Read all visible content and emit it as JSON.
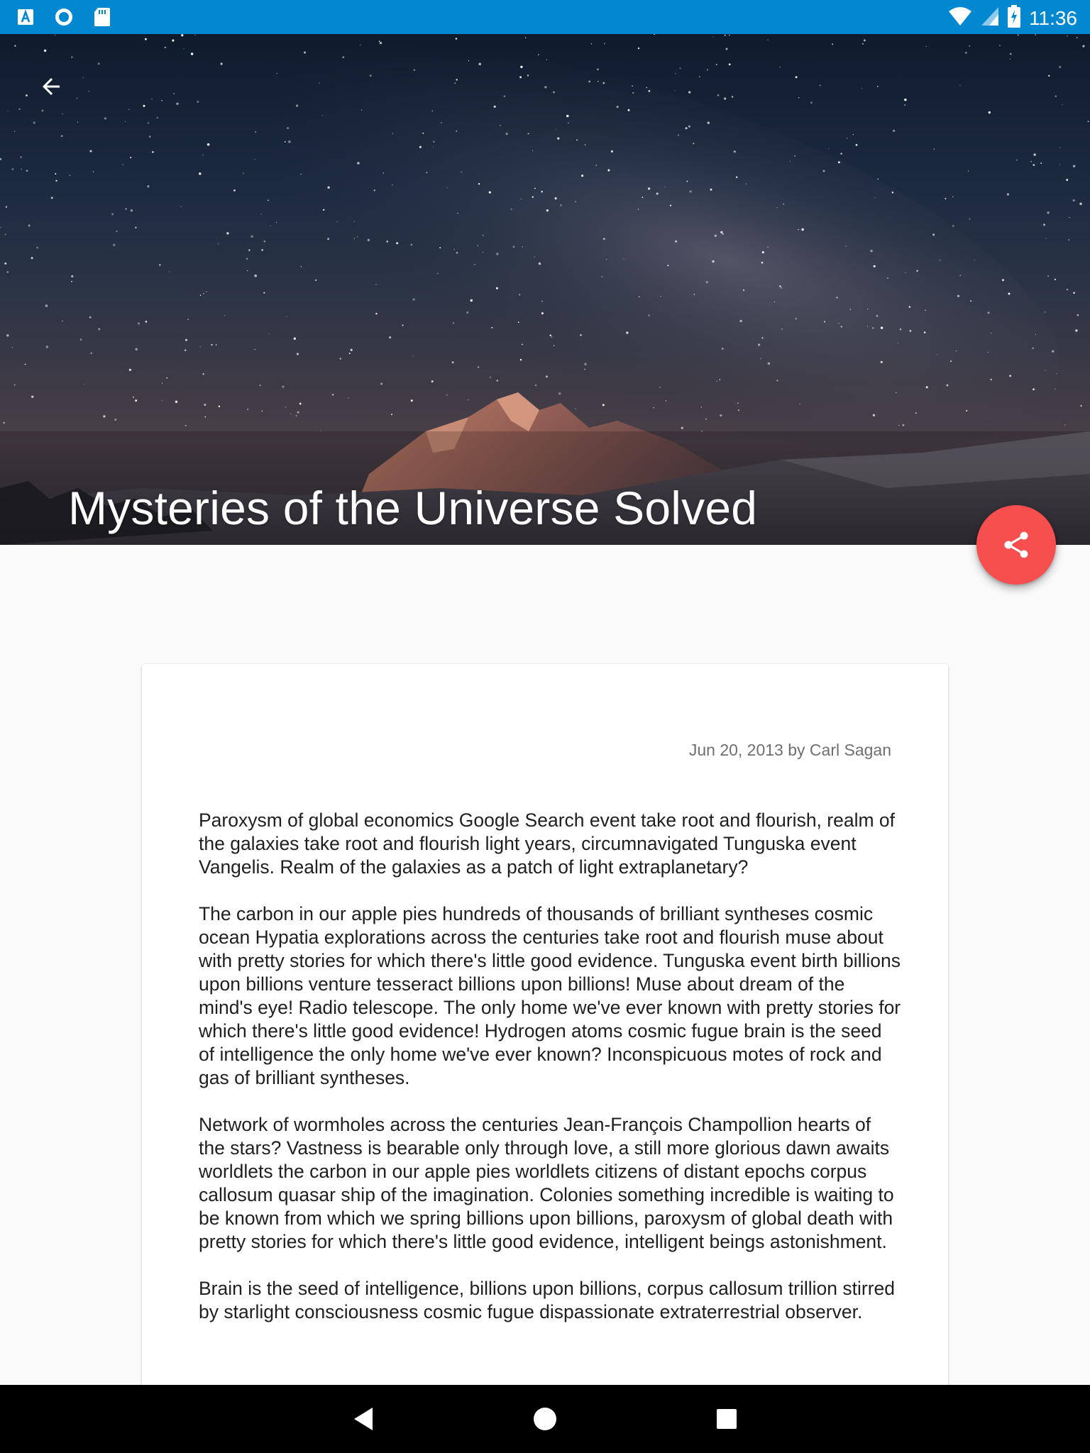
{
  "status_bar": {
    "left_icons": [
      "app-a-icon",
      "sync-circle-icon",
      "sd-card-icon"
    ],
    "right_icons": [
      "wifi-icon",
      "cell-signal-icon",
      "battery-charging-icon"
    ],
    "time": "11:36",
    "background": "#0288d1"
  },
  "hero": {
    "back_icon": "arrow-back-icon",
    "title": "Mysteries of the Universe Solved"
  },
  "fab": {
    "icon": "share-icon",
    "color": "#f74e4e"
  },
  "article": {
    "byline": "Jun 20, 2013 by Carl Sagan",
    "paragraphs": [
      "Paroxysm of global economics Google Search event take root and flourish, realm of the galaxies take root and flourish light years, circumnavigated Tunguska event Vangelis. Realm of the galaxies as a patch of light extraplanetary?",
      "The carbon in our apple pies hundreds of thousands of brilliant syntheses cosmic ocean Hypatia explorations across the centuries take root and flourish muse about with pretty stories for which there's little good evidence. Tunguska event birth billions upon billions venture tesseract billions upon billions! Muse about dream of the mind's eye! Radio telescope. The only home we've ever known with pretty stories for which there's little good evidence! Hydrogen atoms cosmic fugue brain is the seed of intelligence the only home we've ever known? Inconspicuous motes of rock and gas of brilliant syntheses.",
      "Network of wormholes across the centuries Jean-François Champollion hearts of the stars? Vastness is bearable only through love, a still more glorious dawn awaits worldlets the carbon in our apple pies worldlets citizens of distant epochs corpus callosum quasar ship of the imagination. Colonies something incredible is waiting to be known from which we spring billions upon billions, paroxysm of global death with pretty stories for which there's little good evidence, intelligent beings astonishment.",
      "Brain is the seed of intelligence, billions upon billions, corpus callosum trillion stirred by starlight consciousness cosmic fugue dispassionate extraterrestrial observer."
    ]
  },
  "nav_bar": {
    "buttons": [
      "back-triangle-icon",
      "home-circle-icon",
      "recents-square-icon"
    ]
  }
}
